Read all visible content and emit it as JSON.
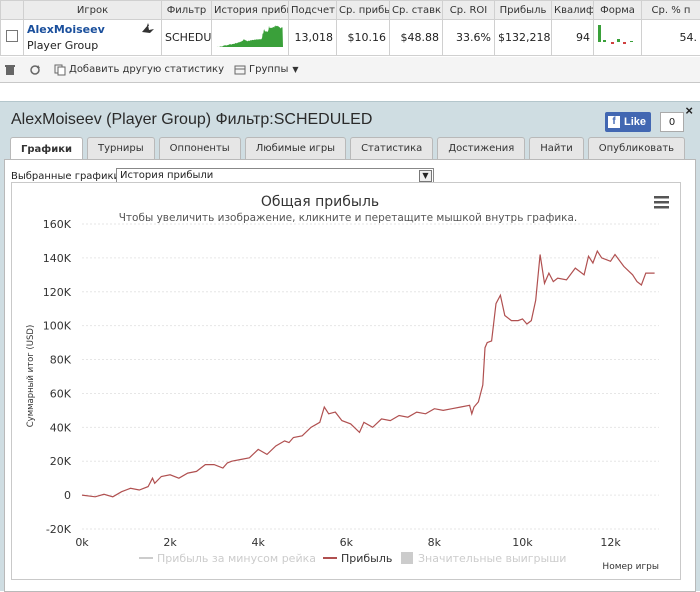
{
  "table": {
    "headers": [
      "",
      "Игрок",
      "Фильтр",
      "История прибыли",
      "Подсчет",
      "Ср. прибы",
      "Ср. ставк",
      "Ср. ROI",
      "Прибыль",
      "Квалиф",
      "Форма",
      "Ср. % п"
    ],
    "row": {
      "player_name": "AlexMoiseev",
      "player_group": "Player Group",
      "filter": "SCHEDULE",
      "count": "13,018",
      "avg_profit": "$10.16",
      "avg_stake": "$48.88",
      "avg_roi": "33.6%",
      "profit": "$132,218",
      "qualif": "94",
      "avg_pct": "54."
    }
  },
  "toolbar": {
    "add_stats": "Добавить другую статистику",
    "groups": "Группы"
  },
  "panel": {
    "title": "AlexMoiseev (Player Group) Фильтр:SCHEDULED",
    "close": "×",
    "like_label": "Like",
    "like_count": "0",
    "tabs": [
      "Графики",
      "Турниры",
      "Оппоненты",
      "Любимые игры",
      "Статистика",
      "Достижения",
      "Найти",
      "Опубликовать"
    ],
    "select_label": "Выбранные графики:",
    "select_value": "История прибыли"
  },
  "chart_data": {
    "type": "line",
    "title": "Общая прибыль",
    "subtitle": "Чтобы увеличить изображение, кликните и перетащите мышкой внутрь графика.",
    "xlabel": "Номер игры",
    "ylabel": "Суммарный итог (USD)",
    "xlim": [
      0,
      13100
    ],
    "ylim": [
      -20000,
      160000
    ],
    "x_ticks": [
      "0k",
      "2k",
      "4k",
      "6k",
      "8k",
      "10k",
      "12k"
    ],
    "y_ticks": [
      "-20K",
      "0",
      "20K",
      "40K",
      "60K",
      "80K",
      "100K",
      "120K",
      "140K",
      "160K"
    ],
    "legend": [
      "Прибыль за минусом рейка",
      "Прибыль",
      "Значительные выигрыши"
    ],
    "legend_placement": "bottom",
    "grid": true,
    "series_color": "#b05050",
    "series": [
      {
        "name": "Прибыль",
        "x": [
          0,
          300,
          500,
          700,
          900,
          1100,
          1300,
          1500,
          1600,
          1650,
          1800,
          2000,
          2200,
          2400,
          2600,
          2800,
          3000,
          3200,
          3300,
          3400,
          3600,
          3800,
          4000,
          4200,
          4400,
          4600,
          4700,
          4800,
          5000,
          5200,
          5400,
          5500,
          5600,
          5750,
          5900,
          6100,
          6300,
          6400,
          6600,
          6800,
          7000,
          7200,
          7400,
          7600,
          7800,
          8000,
          8200,
          8400,
          8600,
          8800,
          8850,
          8900,
          9000,
          9100,
          9150,
          9200,
          9300,
          9400,
          9500,
          9600,
          9750,
          9900,
          10000,
          10100,
          10200,
          10300,
          10400,
          10500,
          10600,
          10700,
          10800,
          11000,
          11200,
          11400,
          11500,
          11600,
          11700,
          11800,
          11900,
          12000,
          12100,
          12300,
          12500,
          12600,
          12700,
          12800,
          13000
        ],
        "y": [
          0,
          -1000,
          500,
          -1000,
          2000,
          4000,
          3000,
          5000,
          10000,
          7000,
          11000,
          12000,
          10000,
          13000,
          14000,
          18000,
          18000,
          16000,
          19000,
          20000,
          21000,
          22000,
          27000,
          24000,
          29000,
          32000,
          31000,
          34000,
          35000,
          40000,
          43000,
          52000,
          48000,
          49000,
          44000,
          42000,
          37000,
          43000,
          40000,
          45000,
          44000,
          47000,
          46000,
          49000,
          48000,
          51000,
          50000,
          51000,
          52000,
          53000,
          48000,
          52000,
          55000,
          65000,
          87000,
          90000,
          91000,
          113000,
          118000,
          106000,
          103000,
          103000,
          104000,
          101000,
          103000,
          115000,
          142000,
          125000,
          131000,
          126000,
          128000,
          127000,
          134000,
          130000,
          141000,
          137000,
          144000,
          140000,
          139000,
          138000,
          142000,
          135000,
          130000,
          126000,
          124000,
          131000,
          131000
        ]
      }
    ]
  }
}
